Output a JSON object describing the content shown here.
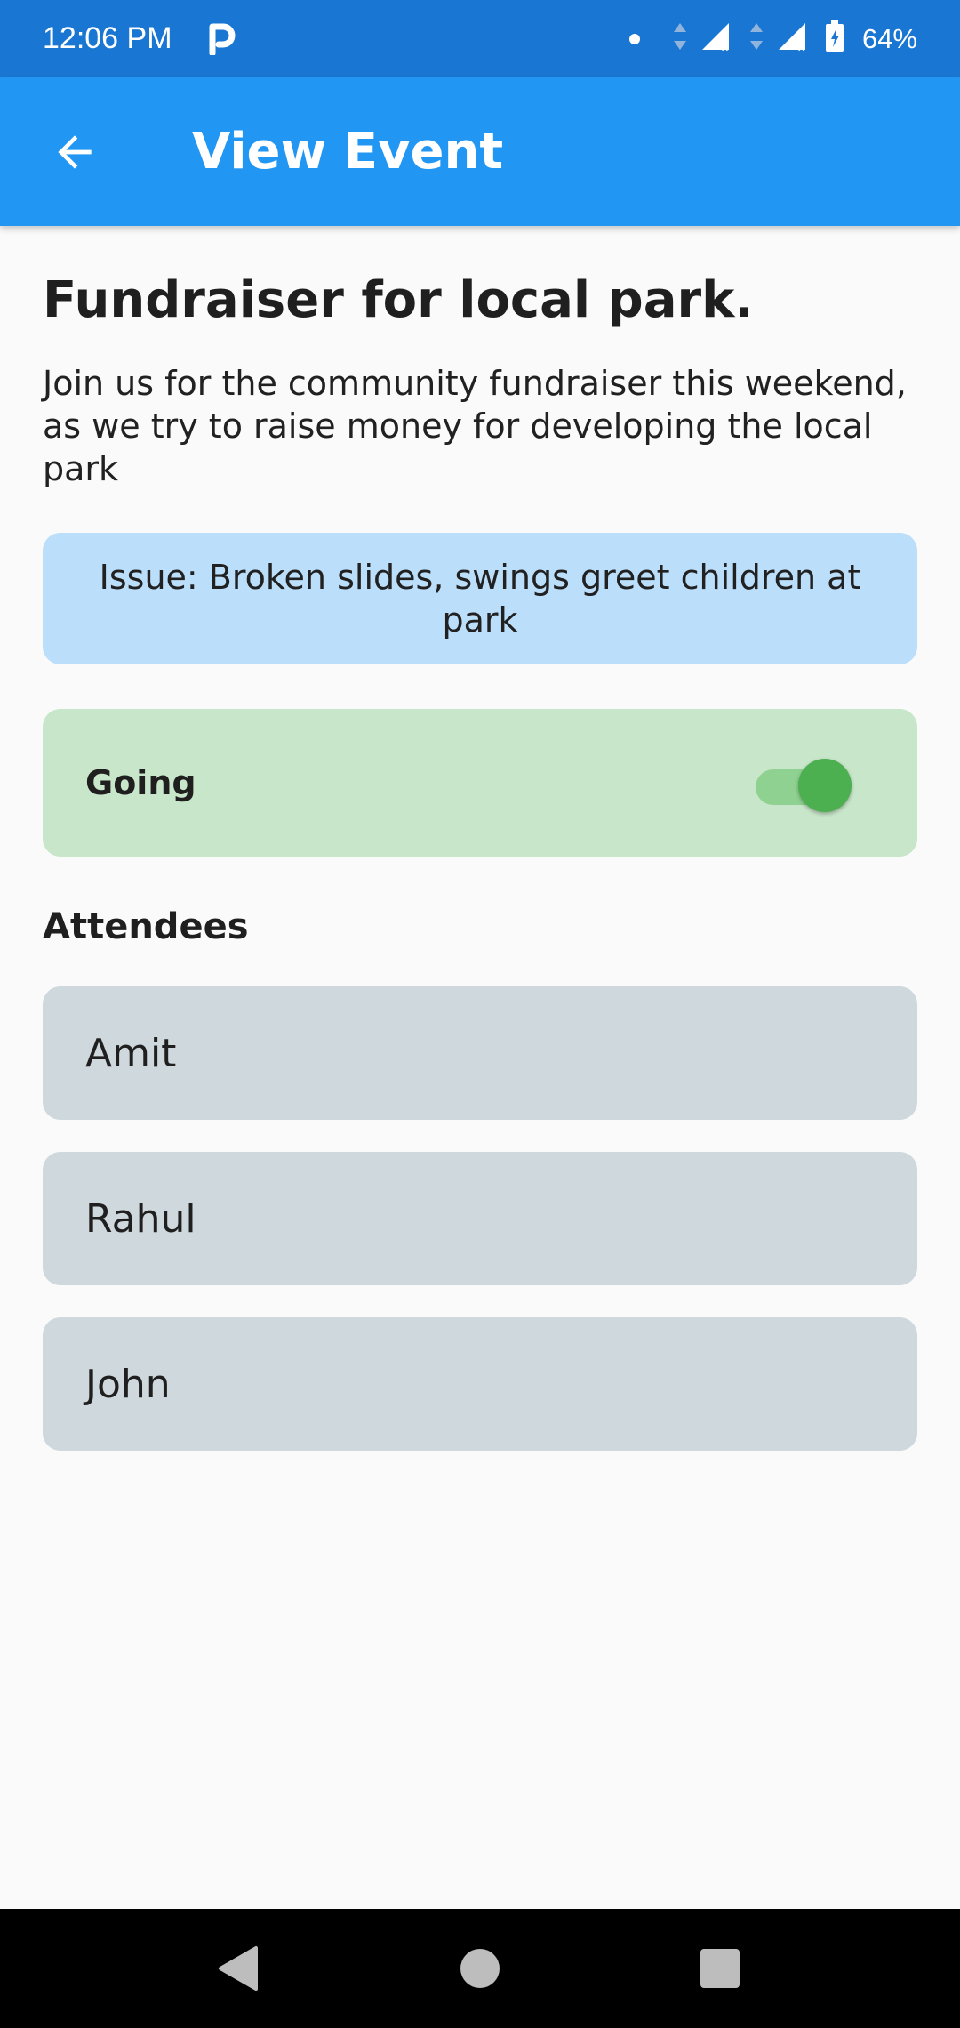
{
  "status_bar": {
    "time": "12:06 PM",
    "battery": "64%",
    "icons": [
      "parking-icon",
      "dot-icon",
      "data-arrows-icon",
      "signal-icon",
      "signal-icon",
      "battery-icon"
    ]
  },
  "app_bar": {
    "title": "View Event",
    "back_icon": "arrow-back-icon"
  },
  "event": {
    "title": "Fundraiser for local park.",
    "description": "Join us for the community fundraiser this weekend, as we try to raise money for developing the local park",
    "issue": "Issue: Broken slides, swings greet children at park"
  },
  "going": {
    "label": "Going",
    "enabled": true
  },
  "attendees": {
    "label": "Attendees",
    "items": [
      "Amit",
      "Rahul",
      "John"
    ]
  },
  "colors": {
    "status_bar": "#1976d2",
    "app_bar": "#2196f3",
    "issue_bg": "#bbdefb",
    "going_bg": "#c8e6c9",
    "toggle_on": "#4caf50",
    "attendee_bg": "#cfd8dc"
  },
  "nav_bar": {
    "icons": [
      "back-triangle-icon",
      "home-circle-icon",
      "recents-square-icon"
    ]
  }
}
